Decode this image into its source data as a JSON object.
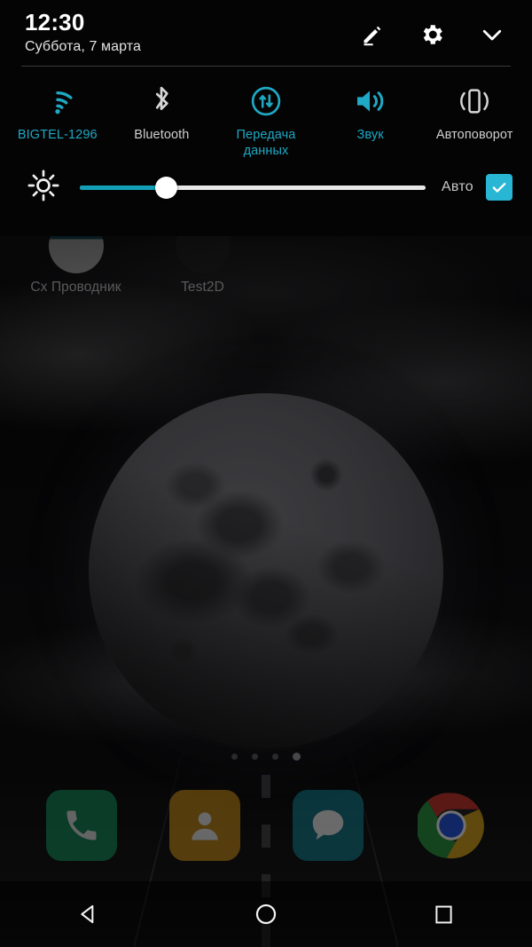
{
  "status": {
    "time": "12:30",
    "date": "Суббота, 7 марта"
  },
  "header_actions": [
    {
      "name": "edit-icon",
      "label": "Изменить"
    },
    {
      "name": "settings-icon",
      "label": "Настройки"
    },
    {
      "name": "collapse-icon",
      "label": "Свернуть"
    }
  ],
  "quick_settings": {
    "tiles": [
      {
        "label": "BIGTEL-1296",
        "icon": "wifi-icon",
        "state": "active"
      },
      {
        "label": "Bluetooth",
        "icon": "bluetooth-icon",
        "state": "inactive"
      },
      {
        "label": "Передача данных",
        "icon": "mobile-data-icon",
        "state": "active"
      },
      {
        "label": "Звук",
        "icon": "sound-icon",
        "state": "active"
      },
      {
        "label": "Автоповорот",
        "icon": "auto-rotate-icon",
        "state": "inactive"
      }
    ],
    "brightness": {
      "icon": "brightness-icon",
      "value_percent": 25,
      "auto_label": "Авто",
      "auto_checked": true
    }
  },
  "homescreen": {
    "apps": [
      {
        "label": "Сх Проводник",
        "icon": "file-explorer-icon"
      },
      {
        "label": "Test2D",
        "icon": "test2d-icon"
      }
    ],
    "page_dots": {
      "count": 4,
      "active_index": 3
    },
    "dock": [
      {
        "label": "Телефон",
        "icon": "phone-icon"
      },
      {
        "label": "Контакты",
        "icon": "contacts-icon"
      },
      {
        "label": "Сообщения",
        "icon": "messages-icon"
      },
      {
        "label": "Chrome",
        "icon": "chrome-icon"
      }
    ]
  },
  "navbar": [
    {
      "label": "Назад",
      "icon": "back-icon"
    },
    {
      "label": "Главная",
      "icon": "home-icon"
    },
    {
      "label": "Обзор",
      "icon": "recents-icon"
    }
  ],
  "colors": {
    "accent_cyan": "#1fa9c4",
    "checkbox_cyan": "#29b6d4",
    "slider_fill": "#12a0b8",
    "inactive_gray": "#cfcfcf",
    "panel_bg": "#040404"
  }
}
